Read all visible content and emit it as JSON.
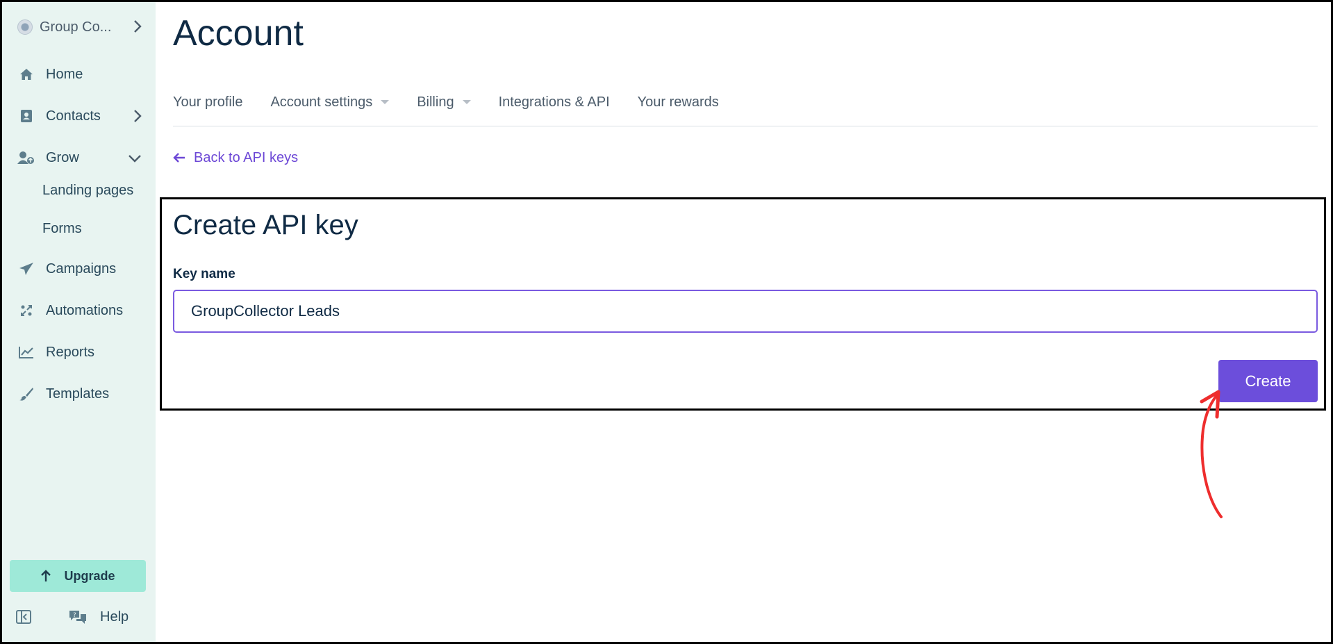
{
  "sidebar": {
    "org_name": "Group Co...",
    "items": [
      {
        "label": "Home",
        "icon": "home-icon"
      },
      {
        "label": "Contacts",
        "icon": "contacts-icon"
      },
      {
        "label": "Grow",
        "icon": "grow-icon"
      },
      {
        "label": "Campaigns",
        "icon": "paper-plane-icon"
      },
      {
        "label": "Automations",
        "icon": "automations-icon"
      },
      {
        "label": "Reports",
        "icon": "chart-icon"
      },
      {
        "label": "Templates",
        "icon": "brush-icon"
      }
    ],
    "grow_subitems": [
      {
        "label": "Landing pages"
      },
      {
        "label": "Forms"
      }
    ],
    "upgrade_label": "Upgrade",
    "help_label": "Help"
  },
  "header": {
    "title": "Account",
    "tabs": [
      {
        "label": "Your profile"
      },
      {
        "label": "Account settings"
      },
      {
        "label": "Billing"
      },
      {
        "label": "Integrations & API"
      },
      {
        "label": "Your rewards"
      }
    ],
    "back_link": "Back to API keys"
  },
  "form": {
    "title": "Create API key",
    "key_name_label": "Key name",
    "key_name_value": "GroupCollector Leads",
    "create_label": "Create"
  },
  "colors": {
    "sidebar_bg": "#e8f4f1",
    "accent": "#6c4edb",
    "upgrade_bg": "#9ee9d8",
    "annotation_arrow": "#ee2d2d"
  }
}
